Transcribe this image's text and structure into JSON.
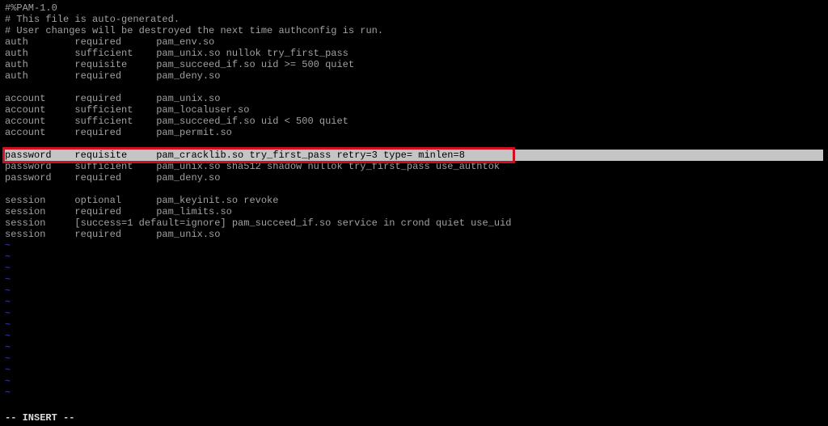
{
  "file": {
    "header": [
      "#%PAM-1.0",
      "# This file is auto-generated.",
      "# User changes will be destroyed the next time authconfig is run."
    ],
    "auth": [
      "auth        required      pam_env.so",
      "auth        sufficient    pam_unix.so nullok try_first_pass",
      "auth        requisite     pam_succeed_if.so uid >= 500 quiet",
      "auth        required      pam_deny.so"
    ],
    "account": [
      "account     required      pam_unix.so",
      "account     sufficient    pam_localuser.so",
      "account     sufficient    pam_succeed_if.so uid < 500 quiet",
      "account     required      pam_permit.so"
    ],
    "highlighted": "password    requisite     pam_cracklib.so try_first_pass retry=3 type= minlen=8",
    "password_rest": [
      "password    sufficient    pam_unix.so sha512 shadow nullok try_first_pass use_authtok",
      "password    required      pam_deny.so"
    ],
    "session": [
      "session     optional      pam_keyinit.so revoke",
      "session     required      pam_limits.so",
      "session     [success=1 default=ignore] pam_succeed_if.so service in crond quiet use_uid",
      "session     required      pam_unix.so"
    ]
  },
  "tilde": "~",
  "status": "-- INSERT --"
}
